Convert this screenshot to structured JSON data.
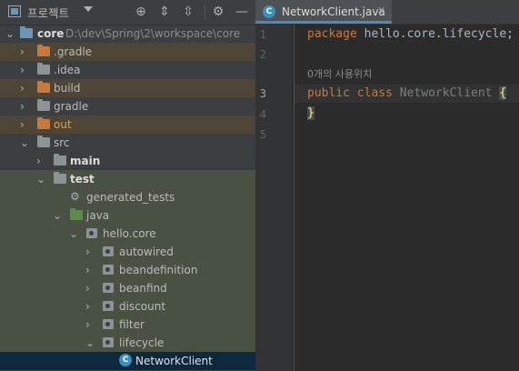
{
  "toolbar": {
    "title": "프로젝트"
  },
  "tree": {
    "root": {
      "name": "core",
      "path": "D:\\dev\\Spring\\2\\workspace\\core"
    },
    "items": [
      {
        "label": ".gradle"
      },
      {
        "label": ".idea"
      },
      {
        "label": "build"
      },
      {
        "label": "gradle"
      },
      {
        "label": "out"
      },
      {
        "label": "src"
      },
      {
        "label": "main"
      },
      {
        "label": "test"
      },
      {
        "label": "generated_tests"
      },
      {
        "label": "java"
      },
      {
        "label": "hello.core"
      },
      {
        "label": "autowired"
      },
      {
        "label": "beandefinition"
      },
      {
        "label": "beanfind"
      },
      {
        "label": "discount"
      },
      {
        "label": "filter"
      },
      {
        "label": "lifecycle"
      },
      {
        "label": "NetworkClient"
      }
    ]
  },
  "editor": {
    "tab": {
      "label": "NetworkClient.java",
      "icon_letter": "C"
    },
    "line_numbers": [
      "1",
      "2",
      "3",
      "4",
      "5"
    ],
    "usage_hint": "0개의 사용위치",
    "code": {
      "line1_kw": "package",
      "line1_rest": " hello.core.lifecycle;",
      "line3_kw1": "public",
      "line3_kw2": "class",
      "line3_name": "NetworkClient",
      "line3_brace": "{",
      "line4_brace": "}"
    }
  },
  "colors": {
    "accent": "#4a88c7",
    "keyword": "#cc7832",
    "selection": "#0d293e"
  }
}
